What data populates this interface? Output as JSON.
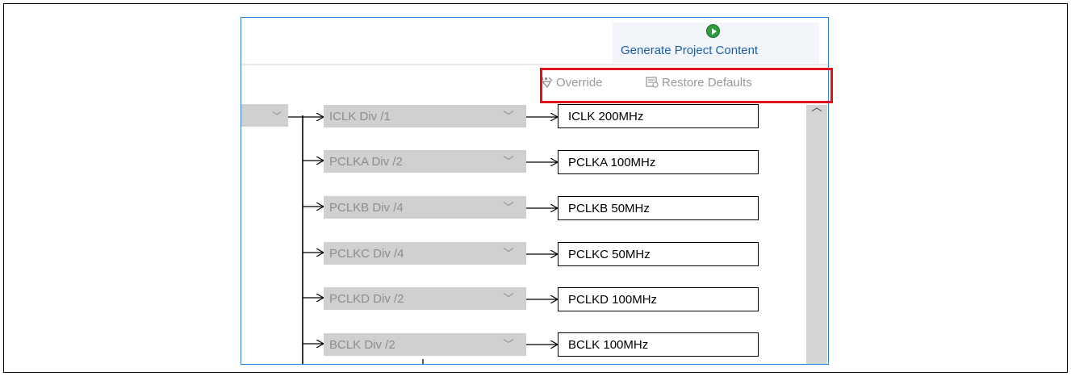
{
  "toolbar": {
    "generate_label": "Generate Project Content",
    "override_label": "Override",
    "restore_label": "Restore Defaults"
  },
  "clocks": [
    {
      "divider": "ICLK Div /1",
      "output": "ICLK 200MHz"
    },
    {
      "divider": "PCLKA Div /2",
      "output": "PCLKA 100MHz"
    },
    {
      "divider": "PCLKB Div /4",
      "output": "PCLKB 50MHz"
    },
    {
      "divider": "PCLKC Div /4",
      "output": "PCLKC 50MHz"
    },
    {
      "divider": "PCLKD Div /2",
      "output": "PCLKD 100MHz"
    },
    {
      "divider": "BCLK Div /2",
      "output": "BCLK 100MHz"
    }
  ],
  "colors": {
    "highlight": "#e0111c",
    "link": "#1c5fa8",
    "select_bg": "#d0d0d0",
    "run_icon": "#2e9b3c"
  },
  "icons": [
    "play-icon",
    "override-icon",
    "restore-defaults-icon",
    "chevron-down-icon",
    "scroll-up-arrow-icon"
  ]
}
